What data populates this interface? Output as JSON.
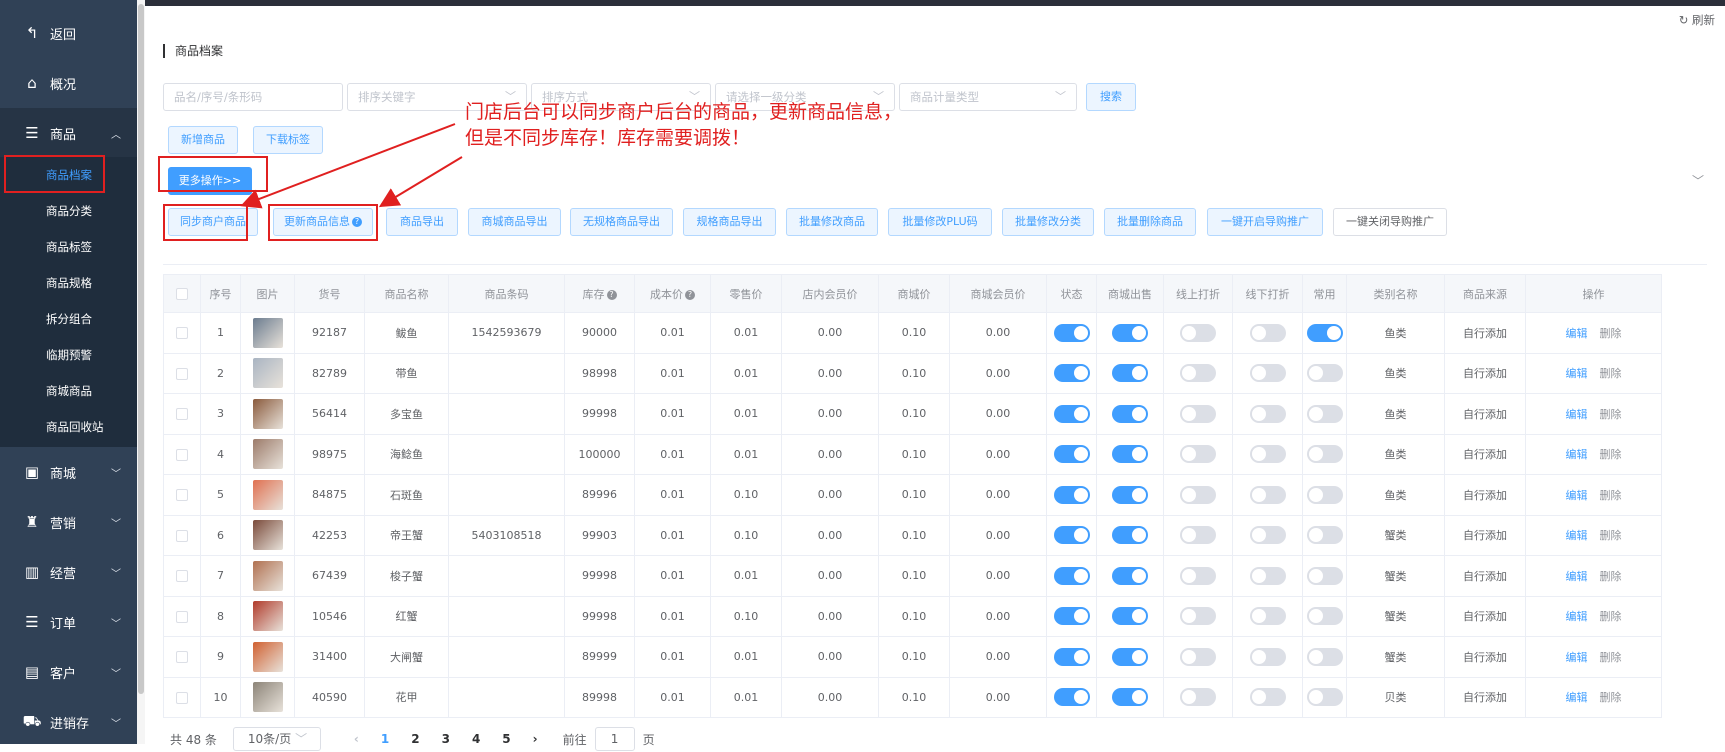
{
  "sidebar": {
    "back": "返回",
    "overview": "概况",
    "goods": "商品",
    "goods_sub": [
      "商品档案",
      "商品分类",
      "商品标签",
      "商品规格",
      "拆分组合",
      "临期预警",
      "商城商品",
      "商品回收站"
    ],
    "mall": "商城",
    "marketing": "营销",
    "operation": "经营",
    "orders": "订单",
    "customers": "客户",
    "inventory": "进销存"
  },
  "header": {
    "refresh": "刷新",
    "title": "商品档案"
  },
  "filters": {
    "name_placeholder": "品名/序号/条形码",
    "sort_key_placeholder": "排序关键字",
    "sort_way_placeholder": "排序方式",
    "category_placeholder": "请选择一级分类",
    "unit_type_placeholder": "商品计量类型",
    "search": "搜索"
  },
  "actions": {
    "add": "新增商品",
    "download_label": "下载标签",
    "more": "更多操作>>",
    "row": [
      "同步商户商品",
      "更新商品信息",
      "商品导出",
      "商城商品导出",
      "无规格商品导出",
      "规格商品导出",
      "批量修改商品",
      "批量修改PLU码",
      "批量修改分类",
      "批量删除商品",
      "一键开启导购推广",
      "一键关闭导购推广"
    ]
  },
  "annotation": {
    "line1": "门店后台可以同步商户后台的商品，更新商品信息，",
    "line2": "但是不同步库存！库存需要调拨！"
  },
  "table": {
    "headers": [
      "序号",
      "图片",
      "货号",
      "商品名称",
      "商品条码",
      "库存",
      "成本价",
      "零售价",
      "店内会员价",
      "商城价",
      "商城会员价",
      "状态",
      "商城出售",
      "线上打折",
      "线下打折",
      "常用",
      "类别名称",
      "商品来源",
      "操作"
    ],
    "edit": "编辑",
    "delete": "删除",
    "rows": [
      {
        "no": "1",
        "code": "92187",
        "name": "鲅鱼",
        "barcode": "1542593679",
        "stock": "90000",
        "cost": "0.01",
        "retail": "0.01",
        "member": "0.00",
        "mall": "0.10",
        "mall_member": "0.00",
        "status": true,
        "mall_sale": true,
        "online": false,
        "offline": false,
        "common": true,
        "category": "鱼类",
        "source": "自行添加",
        "img": "#6b7c8f"
      },
      {
        "no": "2",
        "code": "82789",
        "name": "带鱼",
        "barcode": "",
        "stock": "98998",
        "cost": "0.01",
        "retail": "0.01",
        "member": "0.00",
        "mall": "0.10",
        "mall_member": "0.00",
        "status": true,
        "mall_sale": true,
        "online": false,
        "offline": false,
        "common": false,
        "category": "鱼类",
        "source": "自行添加",
        "img": "#a9b4c2"
      },
      {
        "no": "3",
        "code": "56414",
        "name": "多宝鱼",
        "barcode": "",
        "stock": "99998",
        "cost": "0.01",
        "retail": "0.01",
        "member": "0.00",
        "mall": "0.10",
        "mall_member": "0.00",
        "status": true,
        "mall_sale": true,
        "online": false,
        "offline": false,
        "common": false,
        "category": "鱼类",
        "source": "自行添加",
        "img": "#8a5a3c"
      },
      {
        "no": "4",
        "code": "98975",
        "name": "海鲶鱼",
        "barcode": "",
        "stock": "100000",
        "cost": "0.01",
        "retail": "0.01",
        "member": "0.00",
        "mall": "0.10",
        "mall_member": "0.00",
        "status": true,
        "mall_sale": true,
        "online": false,
        "offline": false,
        "common": false,
        "category": "鱼类",
        "source": "自行添加",
        "img": "#9c7b6a"
      },
      {
        "no": "5",
        "code": "84875",
        "name": "石斑鱼",
        "barcode": "",
        "stock": "89996",
        "cost": "0.01",
        "retail": "0.10",
        "member": "0.00",
        "mall": "0.10",
        "mall_member": "0.00",
        "status": true,
        "mall_sale": true,
        "online": false,
        "offline": false,
        "common": false,
        "category": "鱼类",
        "source": "自行添加",
        "img": "#e07050"
      },
      {
        "no": "6",
        "code": "42253",
        "name": "帝王蟹",
        "barcode": "5403108518",
        "stock": "99903",
        "cost": "0.01",
        "retail": "0.10",
        "member": "0.00",
        "mall": "0.10",
        "mall_member": "0.00",
        "status": true,
        "mall_sale": true,
        "online": false,
        "offline": false,
        "common": false,
        "category": "蟹类",
        "source": "自行添加",
        "img": "#7a4a3a"
      },
      {
        "no": "7",
        "code": "67439",
        "name": "梭子蟹",
        "barcode": "",
        "stock": "99998",
        "cost": "0.01",
        "retail": "0.01",
        "member": "0.00",
        "mall": "0.10",
        "mall_member": "0.00",
        "status": true,
        "mall_sale": true,
        "online": false,
        "offline": false,
        "common": false,
        "category": "蟹类",
        "source": "自行添加",
        "img": "#b07050"
      },
      {
        "no": "8",
        "code": "10546",
        "name": "红蟹",
        "barcode": "",
        "stock": "99998",
        "cost": "0.01",
        "retail": "0.10",
        "member": "0.00",
        "mall": "0.10",
        "mall_member": "0.00",
        "status": true,
        "mall_sale": true,
        "online": false,
        "offline": false,
        "common": false,
        "category": "蟹类",
        "source": "自行添加",
        "img": "#b03a2a"
      },
      {
        "no": "9",
        "code": "31400",
        "name": "大闸蟹",
        "barcode": "",
        "stock": "89999",
        "cost": "0.01",
        "retail": "0.01",
        "member": "0.00",
        "mall": "0.10",
        "mall_member": "0.00",
        "status": true,
        "mall_sale": true,
        "online": false,
        "offline": false,
        "common": false,
        "category": "蟹类",
        "source": "自行添加",
        "img": "#d06030"
      },
      {
        "no": "10",
        "code": "40590",
        "name": "花甲",
        "barcode": "",
        "stock": "89998",
        "cost": "0.01",
        "retail": "0.01",
        "member": "0.00",
        "mall": "0.10",
        "mall_member": "0.00",
        "status": true,
        "mall_sale": true,
        "online": false,
        "offline": false,
        "common": false,
        "category": "贝类",
        "source": "自行添加",
        "img": "#8c8478"
      }
    ]
  },
  "pagination": {
    "total": "共 48 条",
    "page_size": "10条/页",
    "pages": [
      "1",
      "2",
      "3",
      "4",
      "5"
    ],
    "goto_prefix": "前往",
    "goto_value": "1",
    "goto_suffix": "页"
  },
  "colors": {
    "sidebar": "#304156",
    "accent": "#409eff",
    "annotation": "#e02020"
  }
}
